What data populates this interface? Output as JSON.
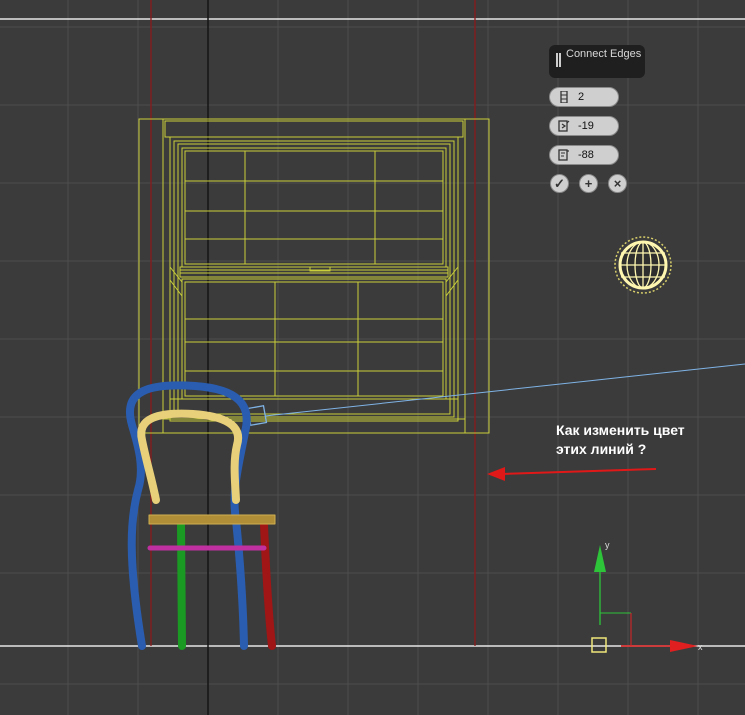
{
  "caddy": {
    "title": "Connect Edges",
    "segments_value": "2",
    "pinch_value": "-19",
    "slide_value": "-88",
    "buttons": [
      "ok",
      "apply-and-continue",
      "cancel"
    ]
  },
  "annotation": {
    "line1": "Как изменить цвет",
    "line2": "этих линий ?"
  },
  "colors": {
    "background": "#3b3b3b",
    "grid": "#4d4d4d",
    "window_wireframe": "#c8cf3a",
    "guide_lines": "#8b1a1a",
    "chair_blue": "#2a5db0",
    "chair_yellow": "#e8cf7a",
    "chair_green": "#1a9a22",
    "chair_red": "#a01515",
    "chair_magenta": "#c030a0",
    "light_sphere": "#fff7b0",
    "camera_line": "#7fb3e6",
    "arrow": "#e01818"
  },
  "icons": [
    "grip-icon",
    "segments-icon",
    "pinch-icon",
    "slide-icon",
    "checkmark-icon",
    "plus-icon",
    "close-icon",
    "gizmo-icon"
  ]
}
